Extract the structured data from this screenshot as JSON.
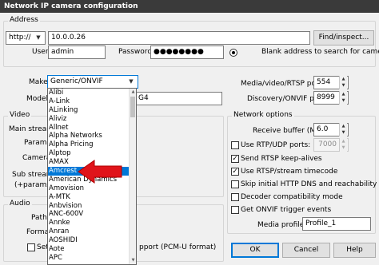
{
  "window": {
    "title": "Network IP camera configuration"
  },
  "address": {
    "group_title": "Address",
    "scheme": "http://",
    "host": "10.0.0.26",
    "find_button": "Find/inspect...",
    "user_label": "User",
    "user": "admin",
    "password_label": "Password",
    "password": "●●●●●●●●",
    "hint": "Blank address to search for cameras"
  },
  "camera": {
    "make_label": "Make",
    "make": "Generic/ONVIF",
    "model_label": "Model",
    "model_tail": "G4",
    "media_port_label": "Media/video/RTSP port",
    "media_port": "554",
    "discovery_port_label": "Discovery/ONVIF port",
    "discovery_port": "8999"
  },
  "video": {
    "group_title": "Video",
    "main_stream_label": "Main stream",
    "params_label": "Params",
    "camera_label": "Camera",
    "sub_stream_label": "Sub stream",
    "sub_params_label": "(+params)"
  },
  "audio": {
    "group_title": "Audio",
    "path_label": "Path",
    "format_label": "Format",
    "setup_label": "Setu",
    "support_text": "pport (PCM-U format)"
  },
  "network_options": {
    "group_title": "Network options",
    "receive_buffer_label": "Receive buffer (MB)",
    "receive_buffer": "6.0",
    "udp_port": "7000",
    "checks": [
      {
        "label": "Use RTP/UDP ports:",
        "checked": false
      },
      {
        "label": "Send RTSP keep-alives",
        "checked": true
      },
      {
        "label": "Use RTSP/stream timecode",
        "checked": true
      },
      {
        "label": "Skip initial HTTP DNS and reachability tests",
        "checked": false
      },
      {
        "label": "Decoder compatibility mode",
        "checked": false
      },
      {
        "label": "Get ONVIF trigger events",
        "checked": false
      }
    ],
    "media_profile_label": "Media profile:",
    "media_profile": "Profile_1"
  },
  "buttons": {
    "ok": "OK",
    "cancel": "Cancel",
    "help": "Help"
  },
  "dropdown": {
    "items": [
      "Alibi",
      "A-Link",
      "ALinking",
      "Aliviz",
      "Allnet",
      "Alpha Networks",
      "Alpha Pricing",
      "Alptop",
      "AMAX",
      "Amcrest",
      "American Dynamics",
      "Amovision",
      "A-MTK",
      "Anbvision",
      "ANC-600V",
      "Annke",
      "Anran",
      "AOSHIDI",
      "Aote",
      "APC"
    ],
    "highlighted": "Amcrest"
  },
  "colors": {
    "highlight": "#0078d7",
    "arrow": "#e0141a"
  }
}
